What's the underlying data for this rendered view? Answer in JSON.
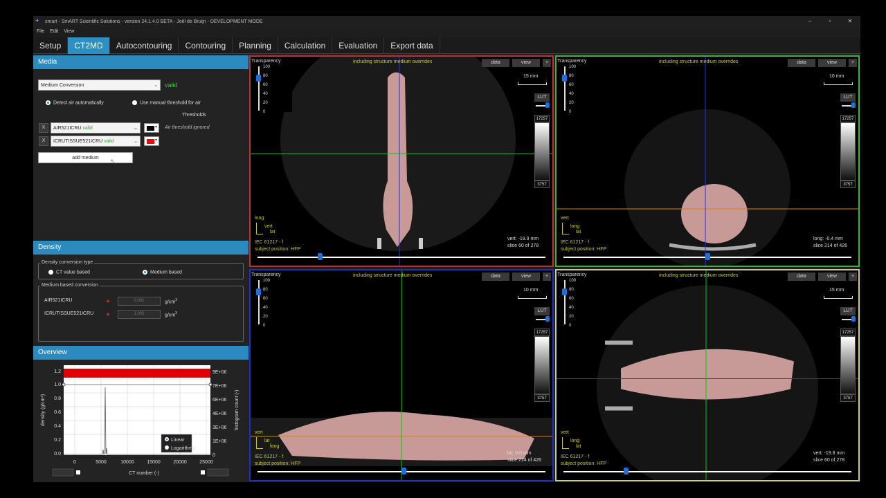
{
  "window": {
    "title": "smart - SmART Scientific Solutions - version 24.1.4.0 BETA - Joël de Bruijn - DEVELOPMENT MODE",
    "controls": [
      "minimize",
      "restore",
      "close"
    ]
  },
  "menu": [
    "File",
    "Edit",
    "View"
  ],
  "tabs": [
    "Setup",
    "CT2MD",
    "Autocontouring",
    "Contouring",
    "Planning",
    "Calculation",
    "Evaluation",
    "Export data"
  ],
  "active_tab": "CT2MD",
  "media": {
    "header": "Media",
    "conversion_select": "Medium Conversion",
    "conversion_status": "valid",
    "radio_auto": "Detect air automatically",
    "radio_manual": "Use manual threshold for air",
    "thresholds_label": "Thresholds",
    "rows": [
      {
        "x": "X",
        "name": "AIR521ICRU",
        "status": "valid",
        "color": "#000000",
        "note": "Air threshold ignored"
      },
      {
        "x": "X",
        "name": "ICRUTISSUE521ICRU",
        "status": "valid",
        "color": "#e01010",
        "note": ""
      }
    ],
    "add_button": "add medium"
  },
  "density": {
    "header": "Density",
    "conversion_type_label": "Density conversion type",
    "opt_ct": "CT value based",
    "opt_medium": "Medium based",
    "medium_label": "Medium based conversion",
    "rows": [
      {
        "name": "AIR521ICRU",
        "value": "0.001",
        "unit": "g/cm",
        "sup": "3"
      },
      {
        "name": "ICRUTISSUE521ICRU",
        "value": "1.000",
        "unit": "g/cm",
        "sup": "3"
      }
    ]
  },
  "overview": {
    "header": "Overview",
    "ylabel": "density  (g/cm³)",
    "y2label": "histogram count (-)",
    "xlabel": "CT number  (-)",
    "yticks": [
      "1.2",
      "1.0",
      "0.8",
      "0.6",
      "0.4",
      "0.2",
      "0.0"
    ],
    "y2ticks": [
      "9E+06",
      "7E+06",
      "6E+06",
      "4E+06",
      "3E+06",
      "1E+06",
      "0"
    ],
    "xticks": [
      "0",
      "5000",
      "10000",
      "15000",
      "20000",
      "25000"
    ],
    "legend_linear": "Linear",
    "legend_log": "Logarithmic",
    "colors": {
      "bar": "#e00000",
      "line": "#dddddd"
    }
  },
  "viewports": [
    {
      "id": "coronal",
      "border": "#c03030",
      "header": "including structure medium overrides",
      "transparency": "Transparency",
      "ticks": [
        "100",
        "80",
        "60",
        "40",
        "20",
        "0"
      ],
      "data": "data",
      "view": "view",
      "plus": "+",
      "scale": "15 mm",
      "lut": "LUT",
      "lut_max": "17257",
      "lut_min": "3757",
      "axis1": "long",
      "axis2": "vert",
      "axis3": "lat",
      "iec": "IEC 61217 - f",
      "position": "subject position: HFP",
      "coord": "vert: -19.9 mm",
      "slice": "slice 60 of 278"
    },
    {
      "id": "axial",
      "border": "#40b040",
      "header": "including structure medium overrides",
      "transparency": "Transparency",
      "ticks": [
        "100",
        "80",
        "60",
        "40",
        "20",
        "0"
      ],
      "data": "data",
      "view": "view",
      "plus": "+",
      "scale": "10 mm",
      "lut": "LUT",
      "lut_max": "17257",
      "lut_min": "3757",
      "axis1": "vert",
      "axis2": "long",
      "axis3": "lat",
      "iec": "IEC 61217 - f",
      "position": "subject position: HFP",
      "coord": "long: -0.4 mm",
      "slice": "slice 214 of 426"
    },
    {
      "id": "sagittal",
      "border": "#2030c0",
      "header": "including structure medium overrides",
      "transparency": "Transparency",
      "ticks": [
        "100",
        "80",
        "60",
        "40",
        "20",
        "0"
      ],
      "data": "data",
      "view": "view",
      "plus": "+",
      "scale": "10 mm",
      "lut": "LUT",
      "lut_max": "17257",
      "lut_min": "3757",
      "axis1": "vert",
      "axis2": "lat",
      "axis3": "long",
      "iec": "IEC 61217 - f",
      "position": "subject position: HFP",
      "coord": "lat: 0.0 mm",
      "slice": "slice 214 of 426"
    },
    {
      "id": "coronal2",
      "border": "#c8c890",
      "header": "including structure medium overrides",
      "transparency": "Transparency",
      "ticks": [
        "100",
        "80",
        "60",
        "40",
        "20",
        "0"
      ],
      "data": "data",
      "view": "view",
      "plus": "+",
      "scale": "15 mm",
      "lut": "LUT",
      "lut_max": "17257",
      "lut_min": "3757",
      "axis1": "vert",
      "axis2": "long",
      "axis3": "lat",
      "iec": "IEC 61217 - f",
      "position": "subject position: HFP",
      "coord": "vert: -19.8 mm",
      "slice": "slice 60 of 278"
    }
  ]
}
